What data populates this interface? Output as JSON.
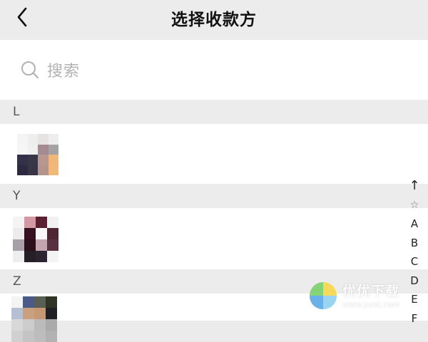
{
  "header": {
    "title": "选择收款方",
    "back_icon": "chevron-left-icon"
  },
  "search": {
    "placeholder": "搜索",
    "icon": "search-icon"
  },
  "sections": [
    {
      "letter": "L"
    },
    {
      "letter": "Y"
    },
    {
      "letter": "Z"
    }
  ],
  "index_bar": [
    "↑",
    "☆",
    "A",
    "B",
    "C",
    "D",
    "E",
    "F"
  ],
  "watermark": {
    "text": "优优下载",
    "url": "www.yyxt.com"
  },
  "colors": {
    "background": "#ebebeb",
    "row_background": "#ffffff",
    "placeholder": "#b2b2b2"
  }
}
